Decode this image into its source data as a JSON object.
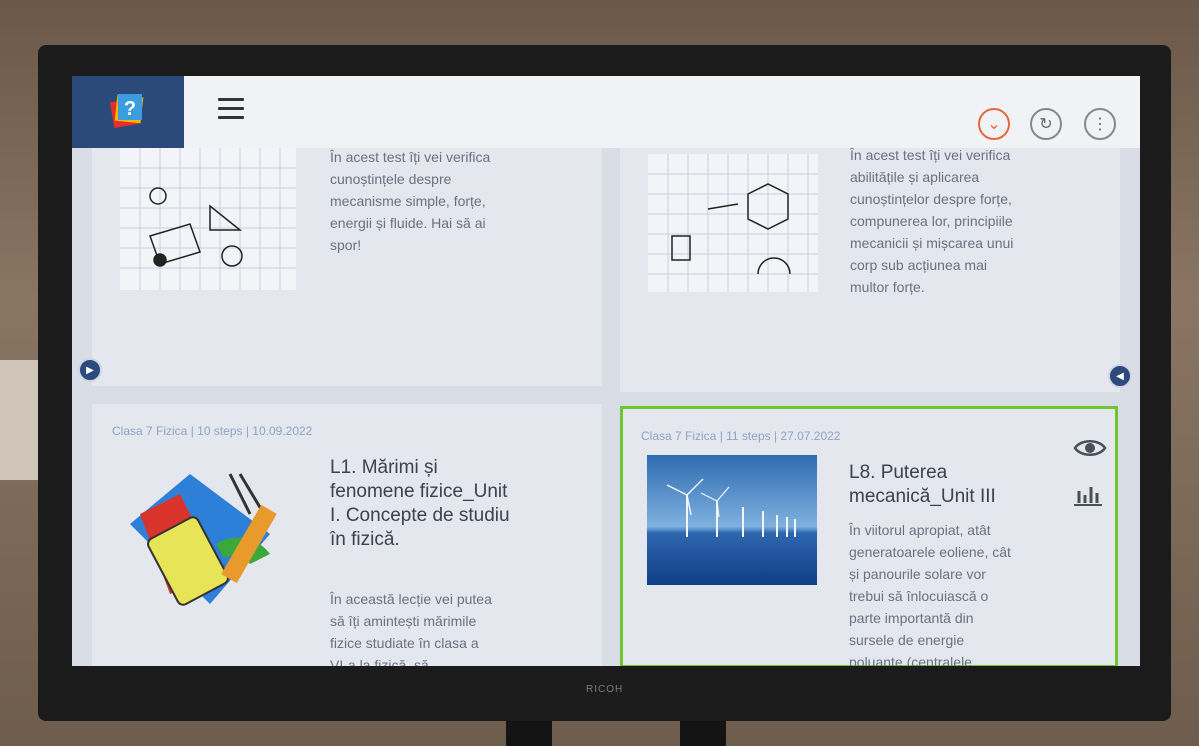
{
  "topbar": {
    "icons": [
      "app-logo-icon",
      "hamburger-menu-icon",
      "chevron-down-icon",
      "refresh-icon",
      "more-vertical-icon"
    ],
    "accent_color": "#e46a3a"
  },
  "cards": [
    {
      "desc": "În acest test îți vei verifica cunoștințele despre mecanisme simple, forțe, energii și fluide. Hai să ai spor!"
    },
    {
      "desc": "În acest test îți vei verifica abilitățile și aplicarea cunoștințelor despre forțe, compunerea lor, principiile mecanicii și mișcarea unui corp sub acțiunea mai multor forțe."
    },
    {
      "meta": "Clasa 7 Fizica | 10 steps | 10.09.2022",
      "title": "L1. Mărimi și fenomene fizice_Unit I. Concepte de studiu în fizică.",
      "desc": "În această lecție vei putea să îți amintești mărimile fizice studiate în clasa a VI-a la fizică, să"
    },
    {
      "meta": "Clasa 7 Fizica | 11 steps | 27.07.2022",
      "title": "L8. Puterea mecanică_Unit III",
      "desc": "În viitorul apropiat, atât generatoarele eoliene, cât și panourile solare vor trebui să înlocuiască o parte importantă din sursele de energie poluante (centralele"
    }
  ],
  "selected_border_color": "#6cc531",
  "tv_brand": "RICOH"
}
